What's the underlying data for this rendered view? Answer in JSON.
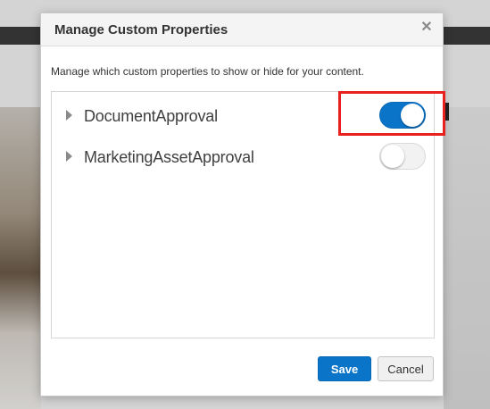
{
  "dialog": {
    "title": "Manage Custom Properties",
    "close_icon": "close-icon",
    "description": "Manage which custom properties to show or hide for your content."
  },
  "properties": [
    {
      "label": "DocumentApproval",
      "enabled": true,
      "expand_icon": "caret-right-icon"
    },
    {
      "label": "MarketingAssetApproval",
      "enabled": false,
      "expand_icon": "caret-right-icon"
    }
  ],
  "buttons": {
    "save_label": "Save",
    "cancel_label": "Cancel"
  },
  "colors": {
    "accent": "#0a74c9",
    "highlight": "#e8211f"
  }
}
